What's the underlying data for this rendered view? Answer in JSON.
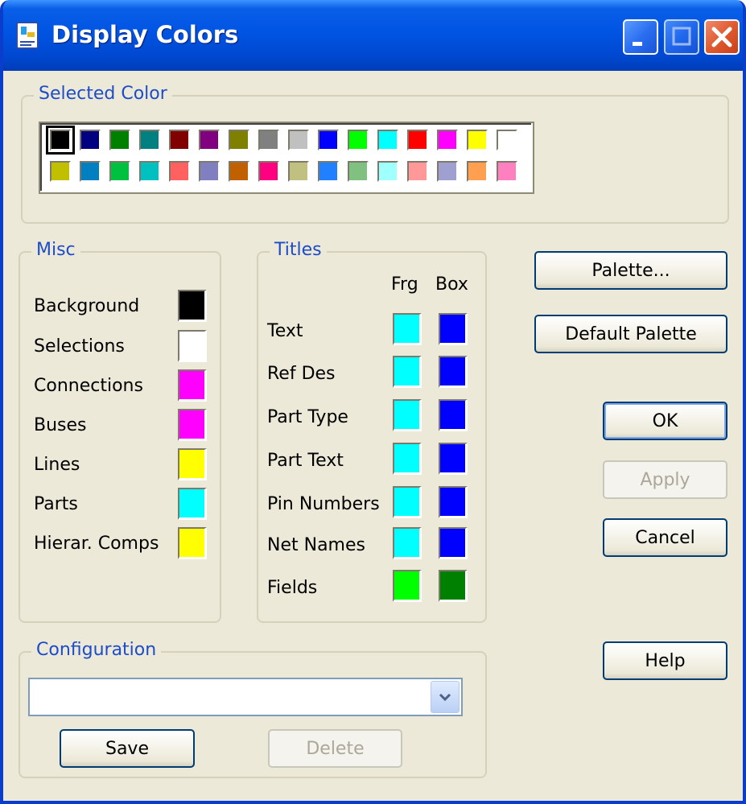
{
  "window": {
    "title": "Display Colors"
  },
  "selected_color": {
    "legend": "Selected Color",
    "palette_row1": [
      "#000000",
      "#000080",
      "#008000",
      "#008080",
      "#800000",
      "#800080",
      "#808000",
      "#808080",
      "#c0c0c0",
      "#0000ff",
      "#00ff00",
      "#00ffff",
      "#ff0000",
      "#ff00ff",
      "#ffff00",
      "#ffffff"
    ],
    "palette_row2": [
      "#c0c000",
      "#0080c0",
      "#00c040",
      "#00c0c0",
      "#ff6060",
      "#8080c0",
      "#c06000",
      "#ff0080",
      "#c0c080",
      "#2080ff",
      "#80c080",
      "#a0ffff",
      "#ff9999",
      "#a0a0d0",
      "#ffa050",
      "#ff80c0"
    ]
  },
  "misc": {
    "legend": "Misc",
    "items": [
      {
        "label": "Background",
        "color": "#000000"
      },
      {
        "label": "Selections",
        "color": "#ffffff"
      },
      {
        "label": "Connections",
        "color": "#ff00ff"
      },
      {
        "label": "Buses",
        "color": "#ff00ff"
      },
      {
        "label": "Lines",
        "color": "#ffff00"
      },
      {
        "label": "Parts",
        "color": "#00ffff"
      },
      {
        "label": "Hierar. Comps",
        "color": "#ffff00"
      }
    ]
  },
  "titles": {
    "legend": "Titles",
    "col_frg": "Frg",
    "col_box": "Box",
    "items": [
      {
        "label": "Text",
        "frg": "#00ffff",
        "box": "#0000ff"
      },
      {
        "label": "Ref Des",
        "frg": "#00ffff",
        "box": "#0000ff"
      },
      {
        "label": "Part Type",
        "frg": "#00ffff",
        "box": "#0000ff"
      },
      {
        "label": "Part Text",
        "frg": "#00ffff",
        "box": "#0000ff"
      },
      {
        "label": "Pin Numbers",
        "frg": "#00ffff",
        "box": "#0000ff"
      },
      {
        "label": "Net Names",
        "frg": "#00ffff",
        "box": "#0000ff"
      },
      {
        "label": "Fields",
        "frg": "#00ff00",
        "box": "#008000"
      }
    ]
  },
  "buttons": {
    "palette": "Palette...",
    "default_palette": "Default Palette",
    "ok": "OK",
    "apply": "Apply",
    "cancel": "Cancel",
    "help": "Help",
    "save": "Save",
    "delete": "Delete"
  },
  "configuration": {
    "legend": "Configuration",
    "value": ""
  }
}
